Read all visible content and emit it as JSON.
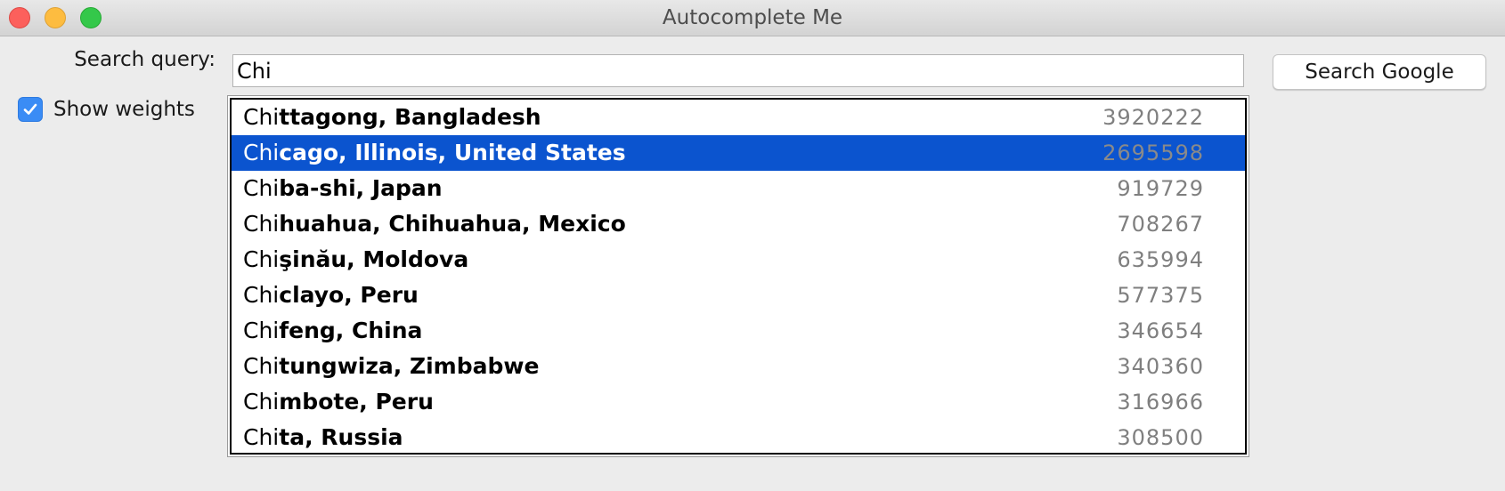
{
  "window": {
    "title": "Autocomplete Me"
  },
  "search": {
    "label": "Search query:",
    "value": "Chi",
    "button_label": "Search Google"
  },
  "options": {
    "show_weights_label": "Show weights",
    "show_weights_checked": true
  },
  "colors": {
    "selection": "#0b54cf",
    "checkbox_accent": "#3a8cf5",
    "weight_text": "#7f7f7f"
  },
  "suggestions": [
    {
      "prefix": "Chi",
      "rest": "ttagong, Bangladesh",
      "weight": "3920222",
      "selected": false
    },
    {
      "prefix": "Chi",
      "rest": "cago, Illinois, United States",
      "weight": "2695598",
      "selected": true
    },
    {
      "prefix": "Chi",
      "rest": "ba-shi, Japan",
      "weight": "919729",
      "selected": false
    },
    {
      "prefix": "Chi",
      "rest": "huahua, Chihuahua, Mexico",
      "weight": "708267",
      "selected": false
    },
    {
      "prefix": "Chi",
      "rest": "şinău, Moldova",
      "weight": "635994",
      "selected": false
    },
    {
      "prefix": "Chi",
      "rest": "clayo, Peru",
      "weight": "577375",
      "selected": false
    },
    {
      "prefix": "Chi",
      "rest": "feng, China",
      "weight": "346654",
      "selected": false
    },
    {
      "prefix": "Chi",
      "rest": "tungwiza, Zimbabwe",
      "weight": "340360",
      "selected": false
    },
    {
      "prefix": "Chi",
      "rest": "mbote, Peru",
      "weight": "316966",
      "selected": false
    },
    {
      "prefix": "Chi",
      "rest": "ta, Russia",
      "weight": "308500",
      "selected": false
    }
  ]
}
